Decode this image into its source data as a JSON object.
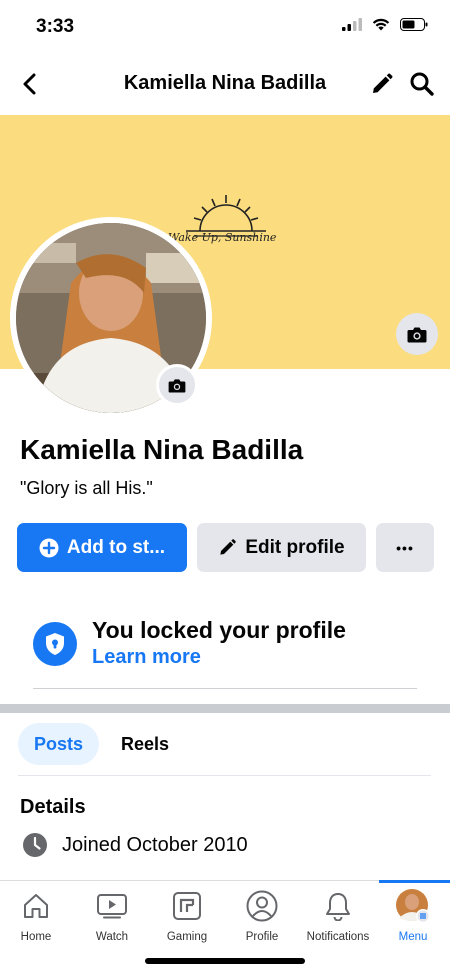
{
  "status_bar": {
    "time": "3:33"
  },
  "header": {
    "title": "Kamiella Nina Badilla"
  },
  "cover": {
    "caption": "Wake Up, Sunshine",
    "background_color": "#fbdc7e"
  },
  "profile": {
    "name": "Kamiella Nina Badilla",
    "bio": "\"Glory is all His.\""
  },
  "actions": {
    "add_to_story": "Add to st...",
    "edit_profile": "Edit profile",
    "more": "•••"
  },
  "locked_notice": {
    "title": "You locked your profile",
    "link": "Learn more"
  },
  "tabs": [
    {
      "label": "Posts",
      "active": true
    },
    {
      "label": "Reels",
      "active": false
    }
  ],
  "details": {
    "heading": "Details",
    "joined": "Joined October 2010"
  },
  "tabbar": {
    "items": [
      {
        "label": "Home",
        "icon": "home-icon"
      },
      {
        "label": "Watch",
        "icon": "watch-icon"
      },
      {
        "label": "Gaming",
        "icon": "gaming-icon"
      },
      {
        "label": "Profile",
        "icon": "profile-icon"
      },
      {
        "label": "Notifications",
        "icon": "bell-icon"
      },
      {
        "label": "Menu",
        "icon": "menu-avatar-icon",
        "active": true
      }
    ]
  },
  "colors": {
    "accent": "#1877f2",
    "button_gray": "#e4e6eb"
  }
}
